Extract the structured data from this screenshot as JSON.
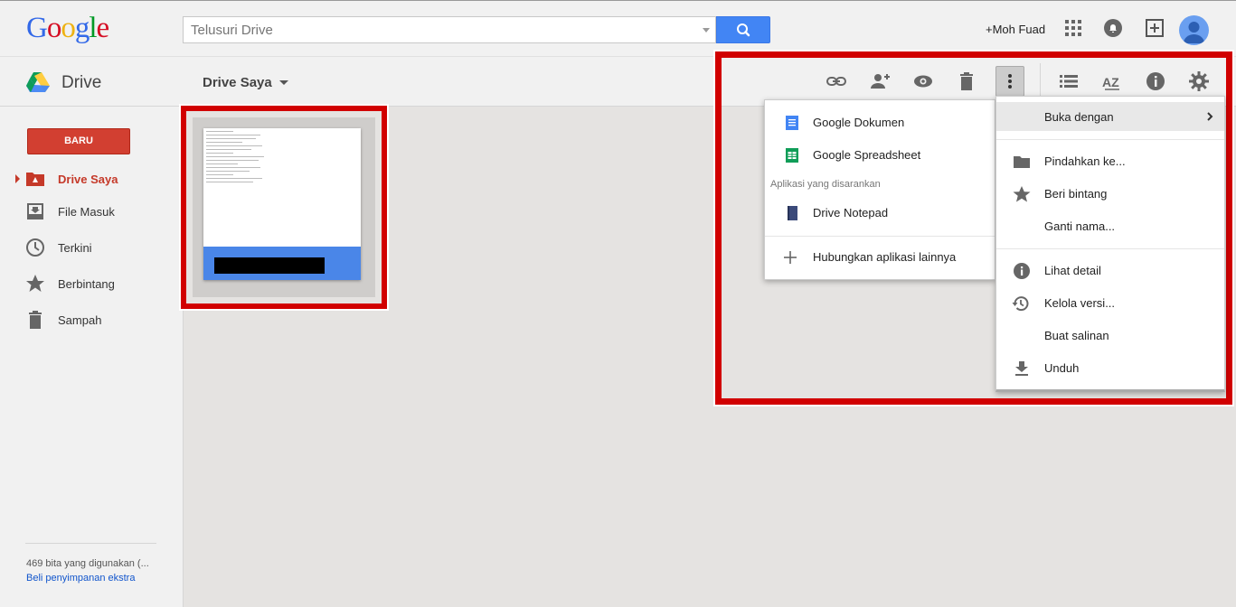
{
  "header": {
    "logo": {
      "letters": [
        "G",
        "o",
        "o",
        "g",
        "l",
        "e"
      ],
      "colors": [
        "#3369e8",
        "#d50f25",
        "#eeb211",
        "#3369e8",
        "#009925",
        "#d50f25"
      ]
    },
    "search": {
      "placeholder": "Telusuri Drive"
    },
    "user_name": "+Moh Fuad",
    "icons": [
      "apps-grid-icon",
      "notifications-icon",
      "share-add-icon",
      "avatar"
    ]
  },
  "subbar": {
    "app_title": "Drive",
    "location": "Drive Saya"
  },
  "sidebar": {
    "new_button": "BARU",
    "items": [
      {
        "label": "Drive Saya",
        "icon": "my-drive-icon",
        "active": true
      },
      {
        "label": "File Masuk",
        "icon": "incoming-icon",
        "active": false
      },
      {
        "label": "Terkini",
        "icon": "clock-icon",
        "active": false
      },
      {
        "label": "Berbintang",
        "icon": "star-icon",
        "active": false
      },
      {
        "label": "Sampah",
        "icon": "trash-icon",
        "active": false
      }
    ],
    "storage_text": "469 bita yang digunakan (...",
    "storage_link": "Beli penyimpanan ekstra"
  },
  "toolbar": {
    "icons": [
      "link-icon",
      "add-person-icon",
      "preview-eye-icon",
      "trash-icon",
      "more-vert-icon",
      "list-view-icon",
      "sort-az-icon",
      "info-icon",
      "settings-gear-icon"
    ]
  },
  "open_with_menu": {
    "items": [
      {
        "label": "Google Dokumen",
        "icon": "google-docs-icon"
      },
      {
        "label": "Google Spreadsheet",
        "icon": "google-sheets-icon"
      }
    ],
    "suggested_heading": "Aplikasi yang disarankan",
    "suggested_items": [
      {
        "label": "Drive Notepad",
        "icon": "notepad-icon"
      }
    ],
    "connect_label": "Hubungkan aplikasi lainnya"
  },
  "more_menu": {
    "items": [
      {
        "label": "Buka dengan",
        "icon": "",
        "submenu": true
      },
      {
        "label": "Pindahkan ke...",
        "icon": "folder-icon"
      },
      {
        "label": "Beri bintang",
        "icon": "star-icon"
      },
      {
        "label": "Ganti nama...",
        "icon": ""
      },
      {
        "label": "Lihat detail",
        "icon": "info-icon"
      },
      {
        "label": "Kelola versi...",
        "icon": "history-icon"
      },
      {
        "label": "Buat salinan",
        "icon": ""
      },
      {
        "label": "Unduh",
        "icon": "download-icon"
      }
    ]
  },
  "colors": {
    "accent_red": "#d23f31",
    "highlight_frame": "#d10000",
    "search_blue": "#4285f4"
  }
}
